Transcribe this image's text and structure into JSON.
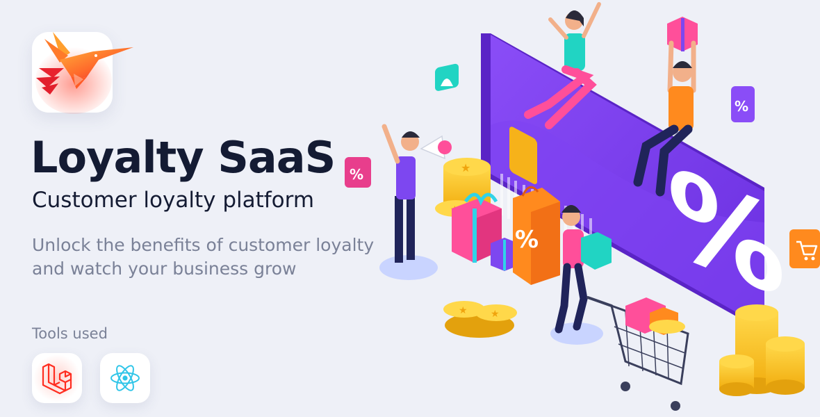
{
  "brand": {
    "title": "Loyalty SaaS",
    "subtitle": "Customer loyalty platform",
    "description": "Unlock the benefits of customer loyalty and watch your business grow",
    "logo_icon": "hummingbird-icon"
  },
  "tools": {
    "label": "Tools used",
    "items": [
      {
        "name": "Laravel",
        "icon": "laravel-icon",
        "color": "#ff2d20"
      },
      {
        "name": "React",
        "icon": "react-icon",
        "color": "#61dafb"
      }
    ]
  },
  "illustration": {
    "card_color": "#7b3ff2",
    "percent_badge_color": "#e83e8c",
    "accent_yellow": "#f7c21a",
    "accent_orange": "#ff8a1e",
    "accent_teal": "#21d4c3"
  }
}
